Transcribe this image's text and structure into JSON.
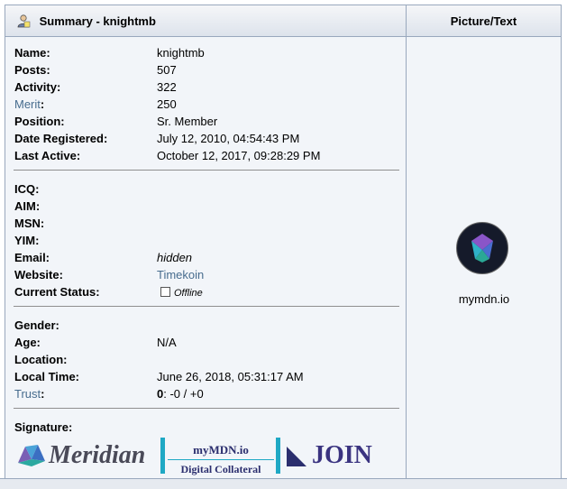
{
  "header": {
    "title": "Summary - knightmb",
    "right_title": "Picture/Text"
  },
  "profile": [
    {
      "label": "Name:",
      "value": "knightmb",
      "link": false
    },
    {
      "label": "Posts:",
      "value": "507",
      "link": false
    },
    {
      "label": "Activity:",
      "value": "322",
      "link": false
    },
    {
      "label": "Merit",
      "value": "250",
      "link": true,
      "suffix": ":"
    },
    {
      "label": "Position:",
      "value": "Sr. Member",
      "link": false
    },
    {
      "label": "Date Registered:",
      "value": "July 12, 2010, 04:54:43 PM",
      "link": false
    },
    {
      "label": "Last Active:",
      "value": "October 12, 2017, 09:28:29 PM",
      "link": false
    }
  ],
  "contact": {
    "icq_label": "ICQ:",
    "aim_label": "AIM:",
    "msn_label": "MSN:",
    "yim_label": "YIM:",
    "email_label": "Email:",
    "email_value": "hidden",
    "website_label": "Website:",
    "website_value": "Timekoin",
    "status_label": "Current Status:",
    "status_value": "Offline"
  },
  "personal": {
    "gender_label": "Gender:",
    "age_label": "Age:",
    "age_value": "N/A",
    "location_label": "Location:",
    "localtime_label": "Local Time:",
    "localtime_value": "June 26, 2018, 05:31:17 AM",
    "trust_label": "Trust",
    "trust_colon": ":",
    "trust_score": "0",
    "trust_detail": ": -0 / +0"
  },
  "signature": {
    "label": "Signature:",
    "meridian": "Meridian",
    "mymdn": "myMDN.io",
    "digital": "Digital Collateral",
    "join": "JOIN"
  },
  "avatar": {
    "caption": "mymdn.io"
  },
  "colors": {
    "link": "#476c8e",
    "header_border": "#99a8bd",
    "accent": "#1fa8c4"
  }
}
